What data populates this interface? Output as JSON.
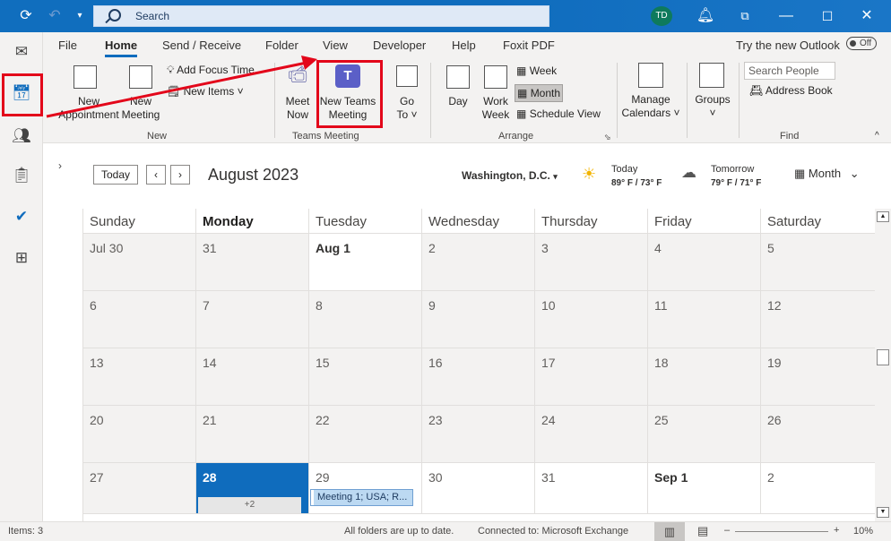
{
  "titlebar": {
    "search_placeholder": "Search",
    "avatar_initials": "TD"
  },
  "menu": {
    "items": [
      "File",
      "Home",
      "Send / Receive",
      "Folder",
      "View",
      "Developer",
      "Help",
      "Foxit PDF"
    ],
    "try_new_outlook": "Try the new Outlook",
    "toggle_state": "Off"
  },
  "ribbon": {
    "new_appointment": "New Appointment",
    "new_meeting_1": "New",
    "new_meeting_2": "Meeting",
    "new_appt_1": "New",
    "new_appt_2": "Appointment",
    "add_focus_time": "Add Focus Time",
    "new_items": "New Items ˅",
    "group_new": "New",
    "meet_now_1": "Meet",
    "meet_now_2": "Now",
    "teams_1": "New Teams",
    "teams_2": "Meeting",
    "group_teams": "Teams Meeting",
    "goto_1": "Go",
    "goto_2": "To ˅",
    "day": "Day",
    "work_week_1": "Work",
    "work_week_2": "Week",
    "week": "Week",
    "month": "Month",
    "schedule_view": "Schedule View",
    "group_arrange": "Arrange",
    "manage_cal_1": "Manage",
    "manage_cal_2": "Calendars ˅",
    "groups_1": "Groups",
    "groups_2": "˅",
    "search_people": "Search People",
    "address_book": "Address Book",
    "group_find": "Find"
  },
  "calendar": {
    "today_button": "Today",
    "month_title": "August 2023",
    "location": "Washington, D.C.",
    "weather_today_label": "Today",
    "weather_today_temp": "89° F / 73° F",
    "weather_tomorrow_label": "Tomorrow",
    "weather_tomorrow_temp": "79° F / 71° F",
    "view_selector": "Month",
    "day_headers": [
      "Sunday",
      "Monday",
      "Tuesday",
      "Wednesday",
      "Thursday",
      "Friday",
      "Saturday"
    ],
    "weeks": [
      [
        "Jul 30",
        "31",
        "Aug 1",
        "2",
        "3",
        "4",
        "5"
      ],
      [
        "6",
        "7",
        "8",
        "9",
        "10",
        "11",
        "12"
      ],
      [
        "13",
        "14",
        "15",
        "16",
        "17",
        "18",
        "19"
      ],
      [
        "20",
        "21",
        "22",
        "23",
        "24",
        "25",
        "26"
      ],
      [
        "27",
        "28",
        "29",
        "30",
        "31",
        "Sep 1",
        "2"
      ]
    ],
    "more_items": "+2",
    "event_label": "Meeting 1; USA; R..."
  },
  "status": {
    "items": "Items: 3",
    "sync": "All folders are up to date.",
    "connected": "Connected to: Microsoft Exchange",
    "zoom": "10%"
  },
  "colors": {
    "accent": "#0f6cbd",
    "highlight_red": "#e3061a"
  }
}
